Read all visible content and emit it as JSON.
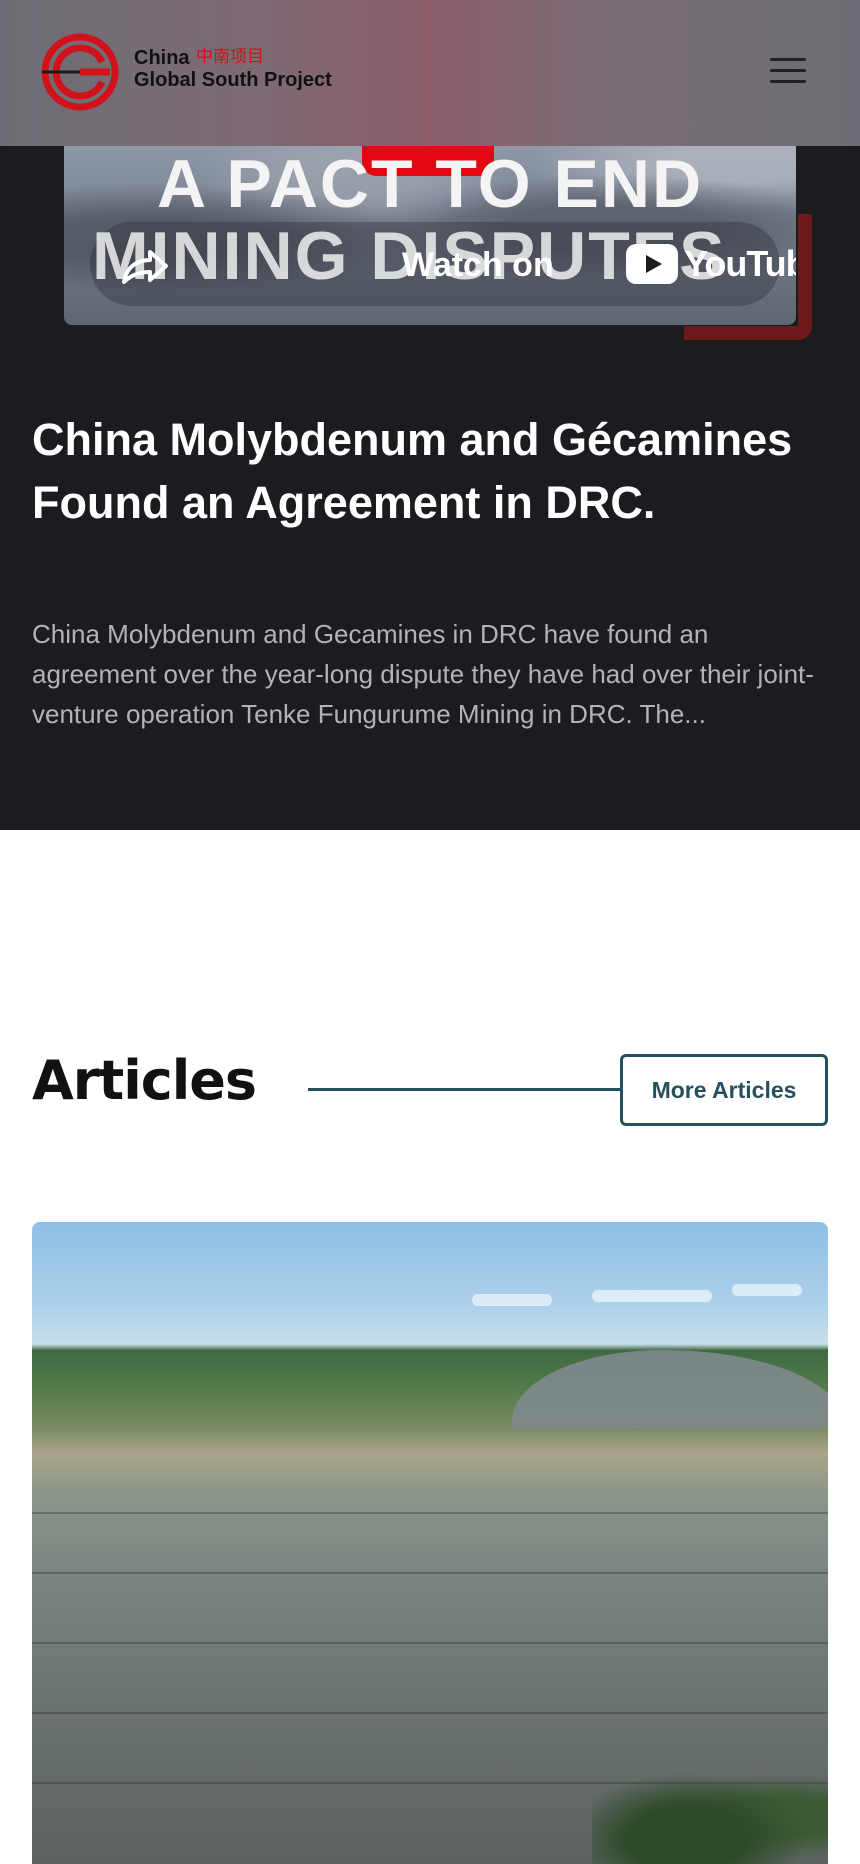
{
  "header": {
    "logo_line1": "China",
    "logo_cn": "中南项目",
    "logo_line2": "Global South Project"
  },
  "video": {
    "thumb_title_line1": "A PACT TO END",
    "thumb_title_line2": "MINING DISPUTES",
    "watch_label": "Watch on",
    "youtube_label": "YouTube"
  },
  "featured": {
    "title": "China Molybdenum and Gécamines Found an Agreement in DRC.",
    "summary": "China Molybdenum and Gecamines in DRC have found an agreement over the year-long dispute they have had over their joint-venture operation Tenke Fungurume Mining in DRC. The..."
  },
  "articles": {
    "heading": "Articles",
    "more_button": "More Articles"
  },
  "colors": {
    "brand_red": "#d0121b",
    "accent_teal": "#27505f",
    "dark_bg": "#1c1b1f"
  },
  "icons": [
    "logo-mark",
    "menu-icon",
    "share-icon",
    "youtube-icon"
  ]
}
